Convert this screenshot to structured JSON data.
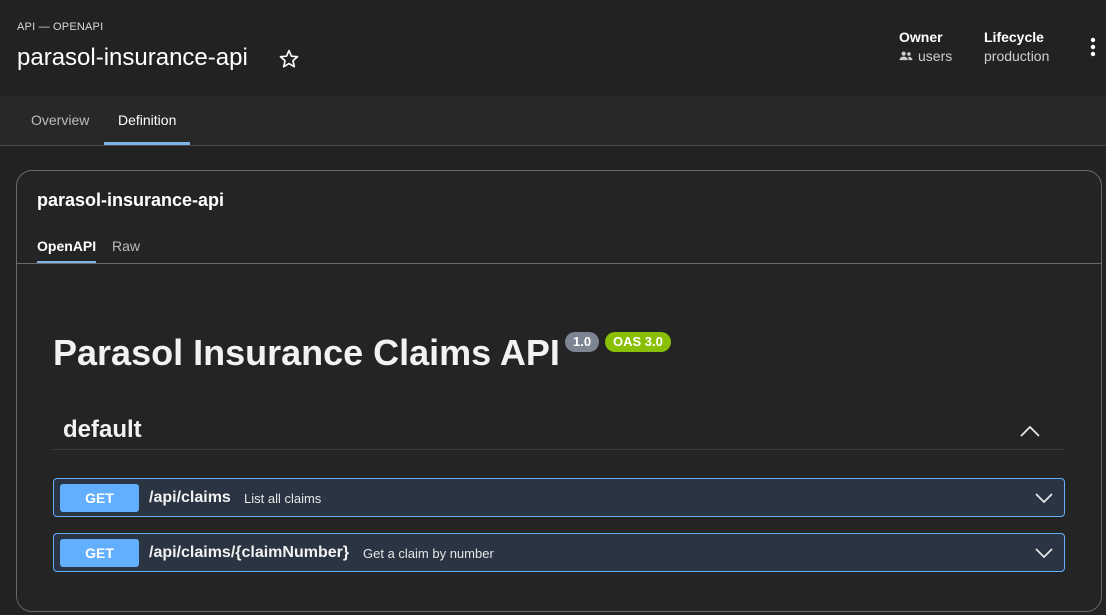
{
  "header": {
    "kind": "API — OPENAPI",
    "title": "parasol-insurance-api",
    "owner_label": "Owner",
    "owner_value": "users",
    "lifecycle_label": "Lifecycle",
    "lifecycle_value": "production"
  },
  "tabs": [
    {
      "label": "Overview",
      "active": false
    },
    {
      "label": "Definition",
      "active": true
    }
  ],
  "card": {
    "title": "parasol-insurance-api",
    "subtabs": [
      {
        "label": "OpenAPI",
        "active": true
      },
      {
        "label": "Raw",
        "active": false
      }
    ]
  },
  "swagger": {
    "title": "Parasol Insurance Claims API",
    "version": "1.0",
    "oas": "OAS 3.0",
    "section": "default",
    "operations": [
      {
        "method": "GET",
        "path": "/api/claims",
        "summary": "List all claims"
      },
      {
        "method": "GET",
        "path": "/api/claims/{claimNumber}",
        "summary": "Get a claim by number"
      }
    ]
  },
  "colors": {
    "accent": "#7fb6e8",
    "get_method": "#61affe",
    "oas_badge": "#89bf04",
    "version_badge": "#7d8492"
  },
  "icons": [
    "star-icon",
    "users-icon",
    "more-vert-icon",
    "chevron-up-icon",
    "chevron-down-icon"
  ]
}
